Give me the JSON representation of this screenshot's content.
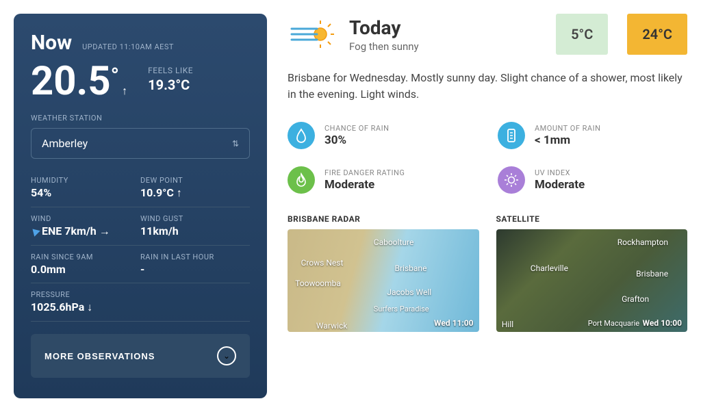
{
  "now": {
    "title": "Now",
    "updated": "UPDATED 11:10AM AEST",
    "temp": "20.5",
    "temp_trend": "↑",
    "feels_label": "FEELS LIKE",
    "feels_value": "19.3°C",
    "station_label": "WEATHER STATION",
    "station_value": "Amberley",
    "obs": {
      "humidity_label": "HUMIDITY",
      "humidity_value": "54%",
      "dew_label": "DEW POINT",
      "dew_value": "10.9°C ↑",
      "wind_label": "WIND",
      "wind_value": "ENE 7km/h →",
      "gust_label": "WIND GUST",
      "gust_value": "11km/h",
      "rain9_label": "RAIN SINCE 9AM",
      "rain9_value": "0.0mm",
      "rainh_label": "RAIN IN LAST HOUR",
      "rainh_value": "-",
      "pressure_label": "PRESSURE",
      "pressure_value": "1025.6hPa ↓"
    },
    "more_label": "MORE OBSERVATIONS"
  },
  "today": {
    "title": "Today",
    "subtitle": "Fog then sunny",
    "temp_min": "5°C",
    "temp_max": "24°C",
    "forecast": "Brisbane for Wednesday. Mostly sunny day. Slight chance of a shower, most likely in the evening. Light winds.",
    "stats": {
      "rain_chance_label": "CHANCE OF RAIN",
      "rain_chance_value": "30%",
      "rain_amount_label": "AMOUNT OF RAIN",
      "rain_amount_value": "< 1mm",
      "fire_label": "FIRE DANGER RATING",
      "fire_value": "Moderate",
      "uv_label": "UV INDEX",
      "uv_value": "Moderate"
    }
  },
  "maps": {
    "radar_title": "BRISBANE RADAR",
    "radar_time": "Wed 11:00",
    "radar_labels": [
      "Caboolture",
      "Crows Nest",
      "Brisbane",
      "Toowoomba",
      "Jacobs Well",
      "Surfers Paradise",
      "Warwick"
    ],
    "sat_title": "SATELLITE",
    "sat_time": "Wed 10:00",
    "sat_labels": [
      "Rockhampton",
      "Charleville",
      "Brisbane",
      "Grafton",
      "Port Macquarie",
      "Hill"
    ]
  }
}
